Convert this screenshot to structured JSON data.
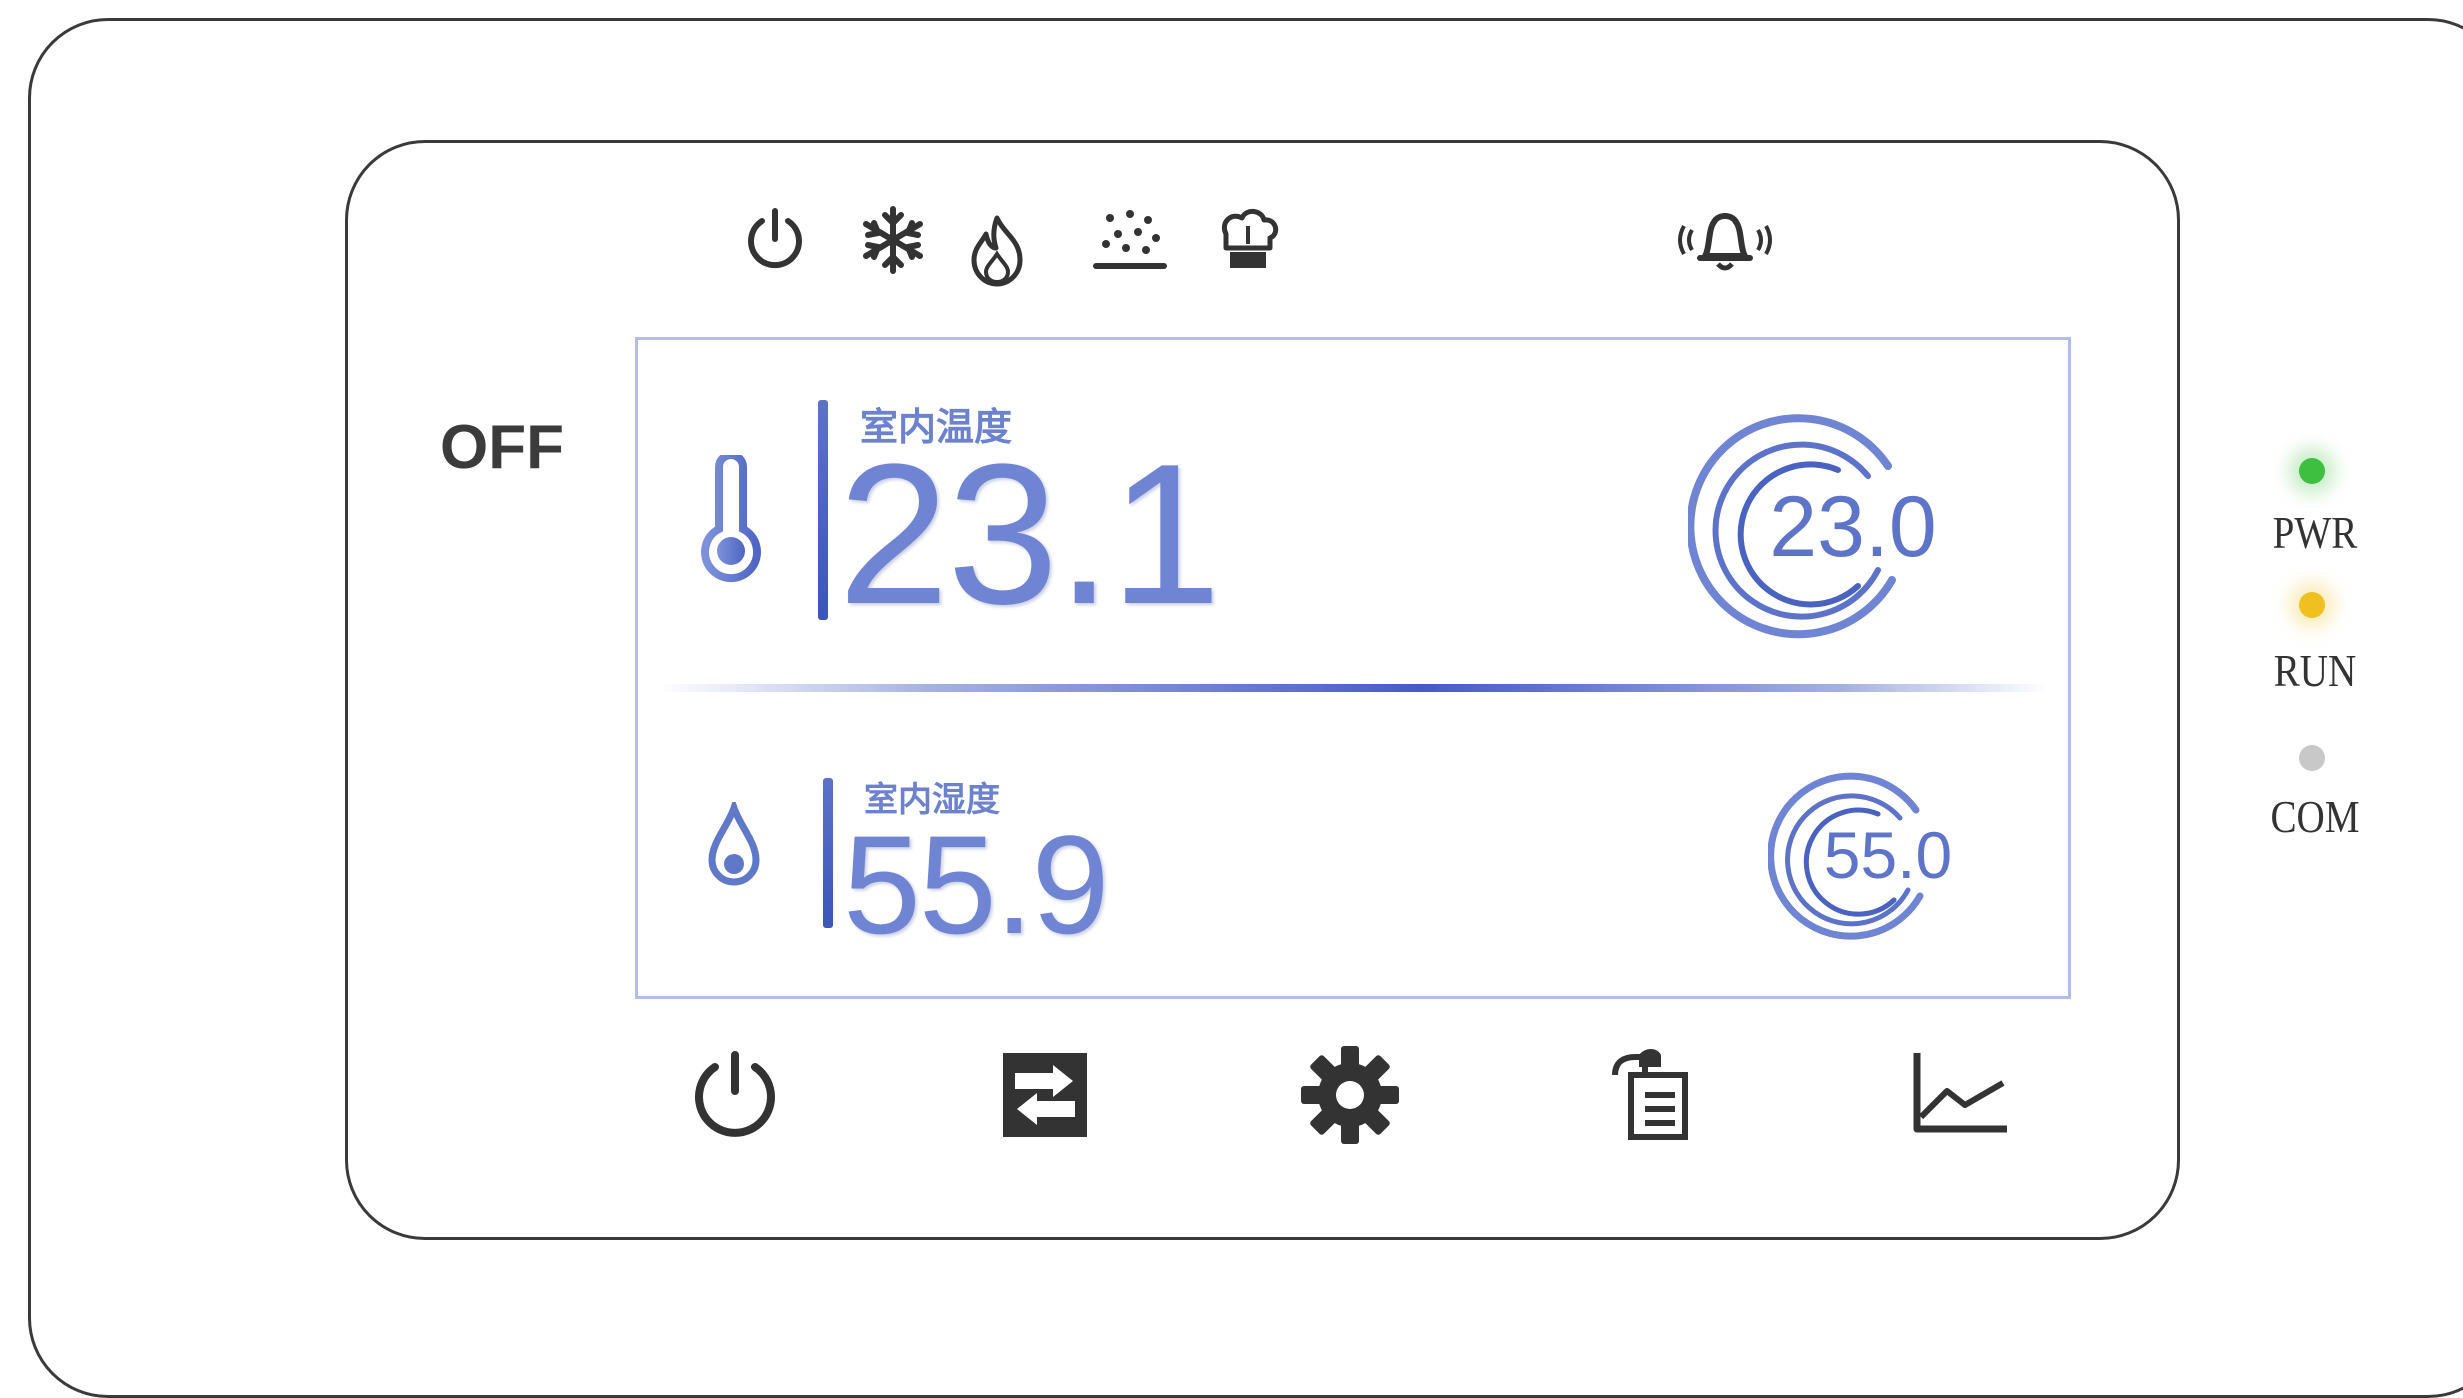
{
  "status": {
    "icons": [
      "power-icon",
      "snowflake-icon",
      "flame-icon",
      "dehumidify-icon",
      "ventilation-icon"
    ],
    "alarm_icon": "bell-alarm-icon"
  },
  "power_state": "OFF",
  "temperature": {
    "caption": "室内温度",
    "current": "23.1",
    "setpoint": "23.0",
    "icon": "thermometer-icon"
  },
  "humidity": {
    "caption": "室内湿度",
    "current": "55.9",
    "setpoint": "55.0",
    "icon": "water-drop-icon"
  },
  "toolbar": {
    "buttons": [
      "power-icon",
      "mode-switch-icon",
      "settings-gear-icon",
      "clipboard-icon",
      "trend-chart-icon"
    ]
  },
  "leds": [
    {
      "label": "PWR",
      "color": "#3fbf3f"
    },
    {
      "label": "RUN",
      "color": "#f0c020"
    },
    {
      "label": "COM",
      "color": "#c8c8c8"
    }
  ],
  "colors": {
    "accent": "#6f84d2",
    "screen_border": "#b4bceb"
  }
}
